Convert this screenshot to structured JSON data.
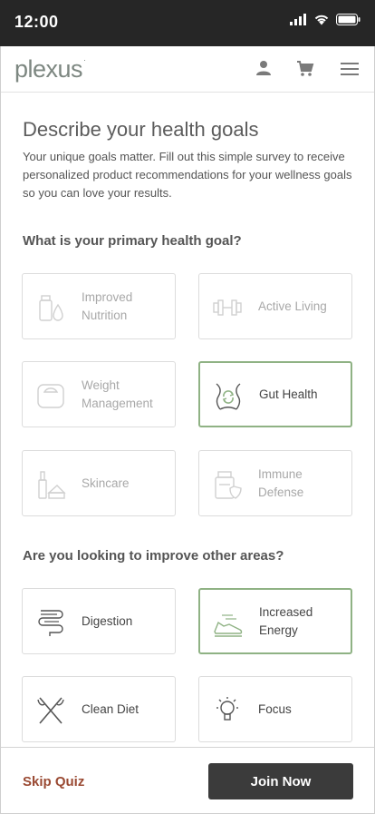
{
  "status_bar": {
    "time": "12:00"
  },
  "header": {
    "logo_text": "plexus",
    "logo_mark": "·"
  },
  "page": {
    "title": "Describe your health goals",
    "intro": "Your unique goals matter. Fill out this simple survey to receive personalized product recommendations for your wellness goals so you can love your results."
  },
  "primary_question": "What is your primary health goal?",
  "primary_options": [
    {
      "label": "Improved Nutrition",
      "icon": "nutrition-bottle-icon",
      "selected": false
    },
    {
      "label": "Active Living",
      "icon": "dumbbell-icon",
      "selected": false
    },
    {
      "label": "Weight Management",
      "icon": "scale-icon",
      "selected": false
    },
    {
      "label": "Gut Health",
      "icon": "gut-icon",
      "selected": true
    },
    {
      "label": "Skincare",
      "icon": "skincare-icon",
      "selected": false
    },
    {
      "label": "Immune Defense",
      "icon": "immune-bottle-icon",
      "selected": false
    }
  ],
  "secondary_question": "Are you looking to improve other areas?",
  "secondary_options": [
    {
      "label": "Digestion",
      "icon": "intestine-icon",
      "selected": false
    },
    {
      "label": "Increased Energy",
      "icon": "running-shoe-icon",
      "selected": true
    },
    {
      "label": "Clean Diet",
      "icon": "fork-knife-icon",
      "selected": false
    },
    {
      "label": "Focus",
      "icon": "lightbulb-icon",
      "selected": false
    }
  ],
  "footer": {
    "skip_label": "Skip Quiz",
    "join_label": "Join Now"
  },
  "colors": {
    "accent_green": "#8fb284",
    "skip_red": "#9a4a33",
    "button_dark": "#3b3b3b",
    "status_bar": "#262626"
  }
}
